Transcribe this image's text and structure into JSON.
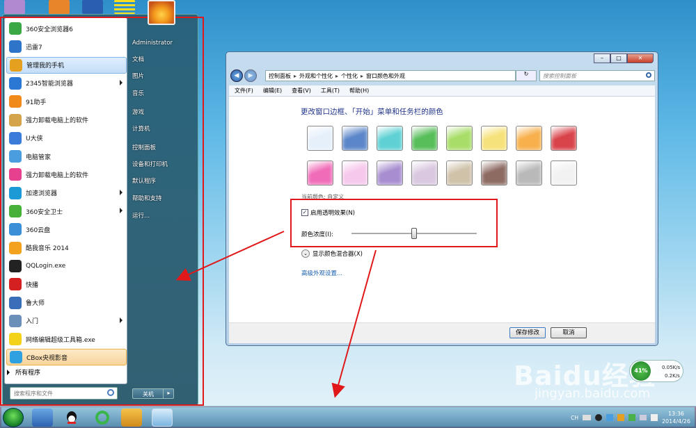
{
  "start_menu": {
    "programs": [
      {
        "label": "360安全浏览器6",
        "color": "#3aa844",
        "has_arrow": false
      },
      {
        "label": "迅雷7",
        "color": "#2e74c9",
        "has_arrow": false
      },
      {
        "label": "管理我的手机",
        "color": "#e6a01f",
        "has_arrow": false,
        "highlight": true
      },
      {
        "label": "2345智能浏览器",
        "color": "#2a77d4",
        "has_arrow": true
      },
      {
        "label": "91助手",
        "color": "#f08a1a",
        "has_arrow": false
      },
      {
        "label": "强力卸载电脑上的软件",
        "color": "#d3a44a",
        "has_arrow": false
      },
      {
        "label": "U大侠",
        "color": "#3b7bd9",
        "has_arrow": false
      },
      {
        "label": "电脑管家",
        "color": "#4a9ee0",
        "has_arrow": false
      },
      {
        "label": "强力卸载电脑上的软件",
        "color": "#e6418e",
        "has_arrow": false
      },
      {
        "label": "加速浏览器",
        "color": "#1c9ad6",
        "has_arrow": true
      },
      {
        "label": "360安全卫士",
        "color": "#46b038",
        "has_arrow": true
      },
      {
        "label": "360云盘",
        "color": "#3a8fd6",
        "has_arrow": false
      },
      {
        "label": "酷我音乐 2014",
        "color": "#f2a21c",
        "has_arrow": false
      },
      {
        "label": "QQLogin.exe",
        "color": "#222222",
        "has_arrow": false
      },
      {
        "label": "快播",
        "color": "#d42020",
        "has_arrow": false
      },
      {
        "label": "鲁大师",
        "color": "#3a6eb8",
        "has_arrow": false
      },
      {
        "label": "入门",
        "color": "#6a8fb8",
        "has_arrow": true
      },
      {
        "label": "网络编辑超级工具箱.exe",
        "color": "#f3d21a",
        "has_arrow": false
      },
      {
        "label": "CBox央视影音",
        "color": "#2fa0e0",
        "has_arrow": false,
        "highlight2": true
      }
    ],
    "all_programs": "所有程序",
    "search_placeholder": "搜索程序和文件",
    "right_items": [
      "Administrator",
      "文档",
      "图片",
      "音乐",
      "游戏",
      "计算机",
      "控制面板",
      "设备和打印机",
      "默认程序",
      "帮助和支持",
      "运行..."
    ],
    "shutdown": "关机",
    "shutdown_arrow": "▸"
  },
  "window": {
    "nav_back": "◀",
    "nav_forward": "▶",
    "breadcrumb": [
      "控制面板",
      "外观和个性化",
      "个性化",
      "窗口颜色和外观"
    ],
    "refresh": "↻",
    "search_placeholder": "搜索控制面板",
    "menu": [
      "文件(F)",
      "编辑(E)",
      "查看(V)",
      "工具(T)",
      "帮助(H)"
    ],
    "title": "更改窗口边框、「开始」菜单和任务栏的颜色",
    "swatch_colors": [
      "#e6f0fb",
      "#5b86c9",
      "#5fd1d4",
      "#57be5a",
      "#a8dd68",
      "#f6e27a",
      "#f7b04c",
      "#d9434a",
      "#f06cb8",
      "#f6c8ec",
      "#a88ed0",
      "#d9c8df",
      "#cfc2a9",
      "#8d6a62",
      "#b9b9b9",
      "#f2f2f2"
    ],
    "current_color": "当前颜色: 自定义",
    "transparency_label": "启用透明效果(N)",
    "transparency_checked": "✓",
    "intensity_label": "颜色浓度(I):",
    "intensity_value": 0.5,
    "mixer_label": "显示颜色混合器(X)",
    "mixer_icon": "⌄",
    "advanced_link": "高级外观设置...",
    "save_button": "保存修改",
    "cancel_button": "取消",
    "title_buttons": [
      "–",
      "□",
      "✕"
    ]
  },
  "speed_widget": {
    "percent": "41%",
    "up": "0.05K/s",
    "down": "0.2K/s"
  },
  "tray": {
    "lang": "CH",
    "time": "13:36",
    "date": "2014/4/26"
  },
  "watermark": {
    "text": "Baidu经验",
    "url": "jingyan.baidu.com"
  },
  "colors": {
    "annotation_red": "#e0181a"
  }
}
